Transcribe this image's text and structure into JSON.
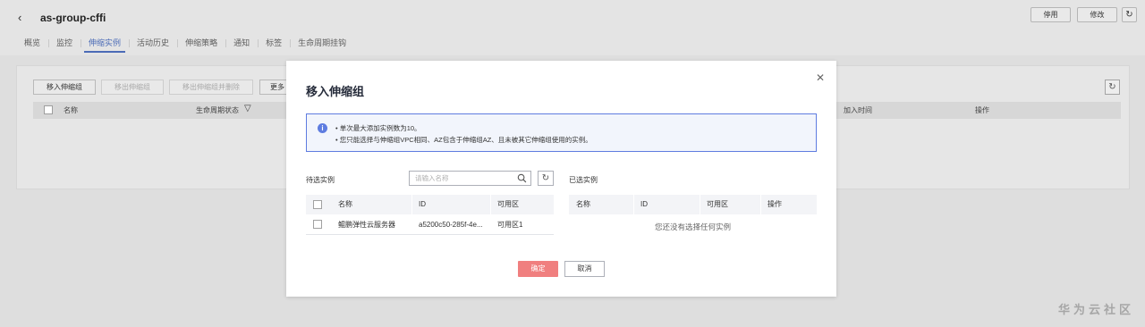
{
  "header": {
    "title": "as-group-cffi",
    "stop_label": "停用",
    "edit_label": "修改"
  },
  "tabs": [
    {
      "label": "概览"
    },
    {
      "label": "监控"
    },
    {
      "label": "伸缩实例"
    },
    {
      "label": "活动历史"
    },
    {
      "label": "伸缩策略"
    },
    {
      "label": "通知"
    },
    {
      "label": "标签"
    },
    {
      "label": "生命周期挂钩"
    }
  ],
  "panel": {
    "buttons": {
      "add": "移入伸缩组",
      "remove": "移出伸缩组",
      "remove_delete": "移出伸缩组并删除",
      "more": "更多"
    },
    "columns": {
      "name": "名称",
      "lifecycle": "生命周期状态",
      "join_time": "加入时间",
      "action": "操作"
    }
  },
  "modal": {
    "title": "移入伸缩组",
    "info": [
      "单次最大添加实例数为10。",
      "您只能选择与伸缩组VPC相同、AZ包含于伸缩组AZ、且未被其它伸缩组使用的实例。"
    ],
    "left": {
      "label": "待选实例",
      "search_placeholder": "请输入名称",
      "columns": {
        "name": "名称",
        "id": "ID",
        "az": "可用区"
      },
      "rows": [
        {
          "name": "鲲鹏弹性云服务器",
          "id": "a5200c50-285f-4e...",
          "az": "可用区1"
        }
      ]
    },
    "right": {
      "label": "已选实例",
      "columns": {
        "name": "名称",
        "id": "ID",
        "az": "可用区",
        "action": "操作"
      },
      "empty": "您还没有选择任何实例"
    },
    "confirm_label": "确定",
    "cancel_label": "取消"
  },
  "watermark": "华为云社区",
  "colors": {
    "accent": "#5e7ce0",
    "confirm": "#f07f7f",
    "active_tab": "#4b6bb6"
  }
}
